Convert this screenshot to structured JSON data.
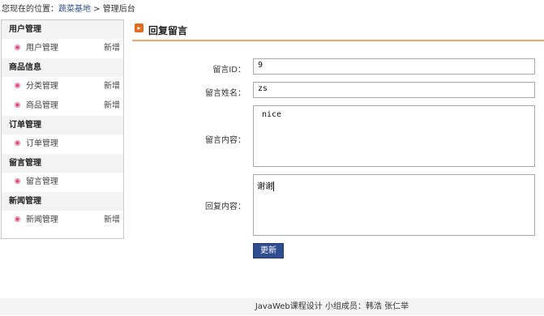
{
  "breadcrumb": {
    "prefix": "您现在的位置：",
    "link": "蔬菜基地",
    "separator": " > ",
    "current": "管理后台"
  },
  "sidebar": {
    "sections": [
      {
        "title": "用户管理",
        "items": [
          {
            "label": "用户管理",
            "action": "新增"
          }
        ]
      },
      {
        "title": "商品信息",
        "items": [
          {
            "label": "分类管理",
            "action": "新增"
          },
          {
            "label": "商品管理",
            "action": "新增"
          }
        ]
      },
      {
        "title": "订单管理",
        "items": [
          {
            "label": "订单管理"
          }
        ]
      },
      {
        "title": "留言管理",
        "items": [
          {
            "label": "留言管理"
          }
        ]
      },
      {
        "title": "新闻管理",
        "items": [
          {
            "label": "新闻管理",
            "action": "新增"
          }
        ]
      }
    ]
  },
  "main": {
    "title": "回复留言",
    "form": {
      "id_label": "留言ID：",
      "id_value": "9",
      "name_label": "留言姓名：",
      "name_value": "zs",
      "content_label": "留言内容：",
      "content_value": "nice",
      "reply_label": "回复内容：",
      "reply_value": "谢谢"
    },
    "submit_label": "更新"
  },
  "footer": {
    "text": "JavaWeb课程设计 小组成员：韩浩 张仁举"
  },
  "colors": {
    "accent": "#f0a868",
    "button": "#2f4d8f",
    "bullet": "#d8336b"
  }
}
